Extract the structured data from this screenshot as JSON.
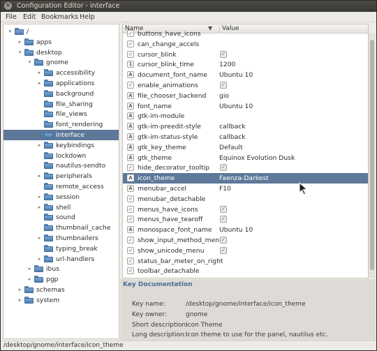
{
  "window": {
    "title": "Configuration Editor - interface",
    "close_glyph": "×"
  },
  "menubar": {
    "items": [
      "File",
      "Edit",
      "Bookmarks",
      "Help"
    ]
  },
  "tree": {
    "items": [
      {
        "label": "/",
        "expander": "▾"
      },
      {
        "label": "apps",
        "expander": "▸"
      },
      {
        "label": "desktop",
        "expander": "▾"
      },
      {
        "label": "gnome",
        "expander": "▾"
      },
      {
        "label": "accessibility",
        "expander": "▸"
      },
      {
        "label": "applications",
        "expander": "▸"
      },
      {
        "label": "background",
        "expander": ""
      },
      {
        "label": "file_sharing",
        "expander": ""
      },
      {
        "label": "file_views",
        "expander": ""
      },
      {
        "label": "font_rendering",
        "expander": ""
      },
      {
        "label": "interface",
        "expander": ""
      },
      {
        "label": "keybindings",
        "expander": "▸"
      },
      {
        "label": "lockdown",
        "expander": ""
      },
      {
        "label": "nautilus-sendto",
        "expander": ""
      },
      {
        "label": "peripherals",
        "expander": "▸"
      },
      {
        "label": "remote_access",
        "expander": ""
      },
      {
        "label": "session",
        "expander": "▸"
      },
      {
        "label": "shell",
        "expander": "▸"
      },
      {
        "label": "sound",
        "expander": ""
      },
      {
        "label": "thumbnail_cache",
        "expander": ""
      },
      {
        "label": "thumbnailers",
        "expander": "▸"
      },
      {
        "label": "typing_break",
        "expander": ""
      },
      {
        "label": "url-handlers",
        "expander": "▸"
      },
      {
        "label": "ibus",
        "expander": "▸"
      },
      {
        "label": "pgp",
        "expander": "▸"
      },
      {
        "label": "schemas",
        "expander": "▸"
      },
      {
        "label": "system",
        "expander": "▸"
      }
    ],
    "selected": "interface"
  },
  "keys_list": {
    "columns": {
      "name": "Name",
      "value": "Value",
      "sort_glyph": "▼"
    },
    "rows": [
      {
        "type": "check",
        "name": "buttons_have_icons",
        "value": ""
      },
      {
        "type": "check",
        "name": "can_change_accels",
        "value": ""
      },
      {
        "type": "check",
        "name": "cursor_blink",
        "value": "✓"
      },
      {
        "type": "num",
        "name": "cursor_blink_time",
        "value": "1200"
      },
      {
        "type": "str",
        "name": "document_font_name",
        "value": "Ubuntu 10"
      },
      {
        "type": "check",
        "name": "enable_animations",
        "value": "✓"
      },
      {
        "type": "str",
        "name": "file_chooser_backend",
        "value": "gio"
      },
      {
        "type": "str",
        "name": "font_name",
        "value": "Ubuntu 10"
      },
      {
        "type": "str",
        "name": "gtk-im-module",
        "value": ""
      },
      {
        "type": "str",
        "name": "gtk-im-preedit-style",
        "value": "callback"
      },
      {
        "type": "str",
        "name": "gtk-im-status-style",
        "value": "callback"
      },
      {
        "type": "str",
        "name": "gtk_key_theme",
        "value": "Default"
      },
      {
        "type": "str",
        "name": "gtk_theme",
        "value": "Equinox Evolution Dusk"
      },
      {
        "type": "check",
        "name": "hide_decorator_tooltip",
        "value": "✓"
      },
      {
        "type": "str",
        "name": "icon_theme",
        "value": "Faenza-Darkest"
      },
      {
        "type": "str",
        "name": "menubar_accel",
        "value": "F10"
      },
      {
        "type": "check",
        "name": "menubar_detachable",
        "value": ""
      },
      {
        "type": "check",
        "name": "menus_have_icons",
        "value": "✓"
      },
      {
        "type": "check",
        "name": "menus_have_tearoff",
        "value": "✓"
      },
      {
        "type": "str",
        "name": "monospace_font_name",
        "value": "Ubuntu 10"
      },
      {
        "type": "check",
        "name": "show_input_method_menu",
        "value": "✓"
      },
      {
        "type": "check",
        "name": "show_unicode_menu",
        "value": "✓"
      },
      {
        "type": "check",
        "name": "status_bar_meter_on_right",
        "value": ""
      },
      {
        "type": "check",
        "name": "toolbar_detachable",
        "value": ""
      }
    ],
    "selected": "icon_theme",
    "type_glyphs": {
      "check": "✓",
      "num": "1",
      "str": "A"
    }
  },
  "key_doc": {
    "title": "Key Documentation",
    "rows": [
      {
        "label": "Key name:",
        "value": "/desktop/gnome/interface/icon_theme"
      },
      {
        "label": "Key owner:",
        "value": "gnome"
      },
      {
        "label": "Short description:",
        "value": "Icon Theme"
      },
      {
        "label": "Long description:",
        "value": "Icon theme to use for the panel, nautilus etc."
      }
    ]
  },
  "statusbar": {
    "path": "/desktop/gnome/interface/icon_theme"
  },
  "colors": {
    "selection": "#5d7898",
    "folder": "#5c8ab9",
    "doc_title": "#4b6e91"
  }
}
